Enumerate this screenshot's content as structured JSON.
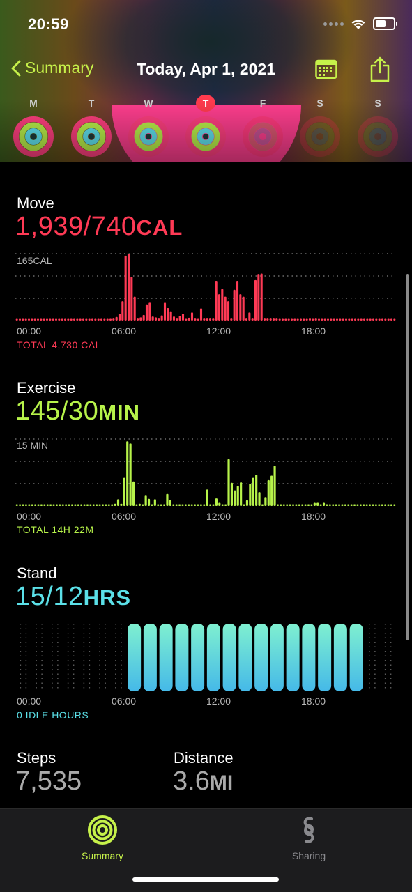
{
  "status": {
    "time": "20:59"
  },
  "nav": {
    "back_label": "Summary",
    "title": "Today, Apr 1, 2021"
  },
  "week": [
    {
      "letter": "M",
      "today": false,
      "dim": false
    },
    {
      "letter": "T",
      "today": false,
      "dim": false
    },
    {
      "letter": "W",
      "today": false,
      "dim": false
    },
    {
      "letter": "T",
      "today": true,
      "dim": false
    },
    {
      "letter": "F",
      "today": false,
      "dim": true
    },
    {
      "letter": "S",
      "today": false,
      "dim": true
    },
    {
      "letter": "S",
      "today": false,
      "dim": true
    }
  ],
  "colors": {
    "move": "#ff3a55",
    "exercise": "#b7f34a",
    "stand": "#5be0e8",
    "accent": "#c6f14a"
  },
  "move": {
    "title": "Move",
    "value": "1,939/740",
    "unit": "CAL",
    "max_label": "165CAL",
    "total": "TOTAL 4,730 CAL"
  },
  "exercise": {
    "title": "Exercise",
    "value": "145/30",
    "unit": "MIN",
    "max_label": "15 MIN",
    "total": "TOTAL 14H 22M"
  },
  "stand": {
    "title": "Stand",
    "value": "15/12",
    "unit": "HRS",
    "total": "0 IDLE HOURS"
  },
  "x_ticks": [
    "00:00",
    "06:00",
    "12:00",
    "18:00"
  ],
  "steps": {
    "title": "Steps",
    "value": "7,535"
  },
  "distance": {
    "title": "Distance",
    "value": "3.6",
    "unit": "MI"
  },
  "tabs": {
    "summary": "Summary",
    "sharing": "Sharing"
  },
  "chart_data": [
    {
      "type": "bar",
      "title": "Move",
      "y_max_label": "165CAL",
      "ylim": [
        0,
        165
      ],
      "x_ticks": [
        "00:00",
        "06:00",
        "12:00",
        "18:00"
      ],
      "values": [
        2,
        2,
        2,
        2,
        2,
        2,
        2,
        2,
        2,
        2,
        2,
        2,
        2,
        2,
        2,
        2,
        2,
        2,
        2,
        2,
        2,
        2,
        2,
        2,
        2,
        2,
        2,
        2,
        2,
        2,
        2,
        2,
        5,
        9,
        17,
        48,
        160,
        165,
        108,
        59,
        5,
        8,
        14,
        40,
        44,
        10,
        8,
        5,
        13,
        44,
        31,
        23,
        10,
        5,
        12,
        17,
        3,
        7,
        20,
        5,
        3,
        30,
        5,
        5,
        5,
        5,
        98,
        65,
        78,
        59,
        48,
        5,
        76,
        98,
        65,
        59,
        5,
        20,
        5,
        100,
        115,
        116,
        5,
        5,
        5,
        5,
        5,
        4,
        3,
        2,
        2,
        2,
        2,
        3,
        2,
        2,
        4,
        5,
        3,
        5,
        2,
        2,
        2,
        3,
        2,
        2,
        2,
        2,
        2,
        2,
        2,
        2,
        2,
        2,
        2,
        2,
        2,
        2,
        2,
        2,
        2,
        2,
        2,
        2,
        2,
        2
      ]
    },
    {
      "type": "bar",
      "title": "Exercise",
      "y_max_label": "15 MIN",
      "ylim": [
        0,
        15
      ],
      "x_ticks": [
        "00:00",
        "06:00",
        "12:00",
        "18:00"
      ],
      "values": [
        0.2,
        0.2,
        0.2,
        0.2,
        0.2,
        0.2,
        0.2,
        0.2,
        0.2,
        0.2,
        0.2,
        0.2,
        0.2,
        0.2,
        0.2,
        0.2,
        0.2,
        0.2,
        0.2,
        0.2,
        0.2,
        0.2,
        0.2,
        0.2,
        0.2,
        0.2,
        0.2,
        0.2,
        0.2,
        0.2,
        0.2,
        0.2,
        0.5,
        1.5,
        0.5,
        6.3,
        14.5,
        14,
        5.5,
        0.3,
        0.5,
        0.3,
        2.3,
        1.6,
        0.3,
        1.5,
        0.4,
        0.2,
        0.2,
        2.7,
        1.3,
        0.3,
        0.3,
        0.3,
        0.3,
        0.3,
        0.3,
        0.3,
        0.3,
        0.3,
        0.3,
        0.3,
        3.7,
        0.3,
        0.3,
        1.7,
        0.7,
        0.3,
        0.3,
        10.5,
        5.2,
        3.5,
        4.5,
        5.3,
        0.3,
        1.3,
        5,
        6.3,
        7,
        3.1,
        0.3,
        2,
        5.8,
        6.8,
        9,
        0.3,
        0.3,
        0.3,
        0.3,
        0.3,
        0.3,
        0.3,
        0.3,
        0.3,
        0.3,
        0.3,
        0.3,
        0.7,
        0.7,
        0.3,
        0.7,
        0.3,
        0.3,
        0.3,
        0.3,
        0.3,
        0.3,
        0.3,
        0.3,
        0.3,
        0.3,
        0.3,
        0.3,
        0.3,
        0.3,
        0.3,
        0.3,
        0.3,
        0.3,
        0.3,
        0.3,
        0.3,
        0.3,
        0.3
      ]
    },
    {
      "type": "bar",
      "title": "Stand",
      "x_ticks": [
        "00:00",
        "06:00",
        "12:00",
        "18:00"
      ],
      "values": [
        0,
        0,
        0,
        0,
        0,
        0,
        0,
        1,
        1,
        1,
        1,
        1,
        1,
        1,
        1,
        1,
        1,
        1,
        1,
        1,
        1,
        1,
        0,
        0
      ]
    }
  ]
}
